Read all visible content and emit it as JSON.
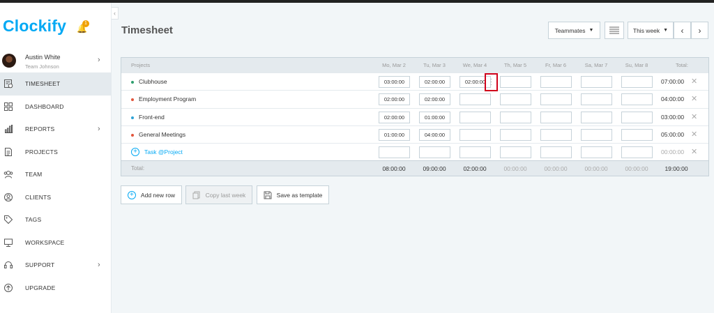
{
  "app": {
    "logo": "Clockify",
    "notification_count": "1"
  },
  "user": {
    "name": "Austin White",
    "team": "Team Johnson"
  },
  "nav": [
    {
      "label": "TIMESHEET",
      "icon": "timesheet-icon",
      "active": true
    },
    {
      "label": "DASHBOARD",
      "icon": "dashboard-icon"
    },
    {
      "label": "REPORTS",
      "icon": "reports-icon",
      "has_arrow": true
    },
    {
      "label": "PROJECTS",
      "icon": "projects-icon"
    },
    {
      "label": "TEAM",
      "icon": "team-icon"
    },
    {
      "label": "CLIENTS",
      "icon": "clients-icon"
    },
    {
      "label": "TAGS",
      "icon": "tag-icon"
    },
    {
      "label": "WORKSPACE",
      "icon": "workspace-icon"
    },
    {
      "label": "SUPPORT",
      "icon": "support-icon",
      "has_arrow": true
    },
    {
      "label": "UPGRADE",
      "icon": "upgrade-icon"
    }
  ],
  "page": {
    "title": "Timesheet",
    "teammates_label": "Teammates",
    "period_label": "This week"
  },
  "table": {
    "header_projects": "Projects",
    "days": [
      "Mo, Mar 2",
      "Tu, Mar 3",
      "We, Mar 4",
      "Th, Mar 5",
      "Fr, Mar 6",
      "Sa, Mar 7",
      "Su, Mar 8"
    ],
    "header_total": "Total:",
    "rows": [
      {
        "project": "Clubhouse",
        "color": "#2e9e6e",
        "values": [
          "03:00:00",
          "02:00:00",
          "02:00:00",
          "",
          "",
          "",
          ""
        ],
        "total": "07:00:00"
      },
      {
        "project": "Employment Program",
        "color": "#e2553c",
        "values": [
          "02:00:00",
          "02:00:00",
          "",
          "",
          "",
          "",
          ""
        ],
        "total": "04:00:00"
      },
      {
        "project": "Front-end",
        "color": "#2fa3d6",
        "values": [
          "02:00:00",
          "01:00:00",
          "",
          "",
          "",
          "",
          ""
        ],
        "total": "03:00:00"
      },
      {
        "project": "General Meetings",
        "color": "#e2553c",
        "values": [
          "01:00:00",
          "04:00:00",
          "",
          "",
          "",
          "",
          ""
        ],
        "total": "05:00:00"
      }
    ],
    "new_row_label": "Task @Project",
    "new_row_total": "00:00:00",
    "footer_label": "Total:",
    "footer_totals": [
      "08:00:00",
      "09:00:00",
      "02:00:00",
      "00:00:00",
      "00:00:00",
      "00:00:00",
      "00:00:00"
    ],
    "footer_grand_total": "19:00:00"
  },
  "actions": {
    "add_row": "Add new row",
    "copy_last_week": "Copy last week",
    "save_template": "Save as template"
  }
}
